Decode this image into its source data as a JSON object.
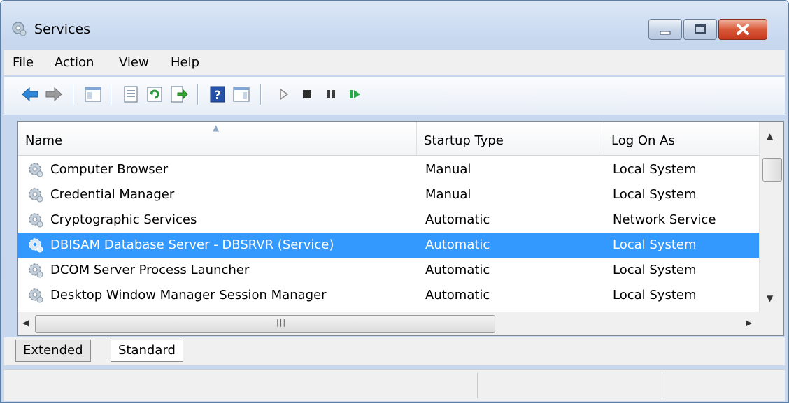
{
  "window": {
    "title": "Services",
    "icon": "services-gear-icon",
    "controls": [
      "minimize-icon",
      "maximize-icon",
      "close-icon"
    ]
  },
  "menu": [
    {
      "label": "File"
    },
    {
      "label": "Action"
    },
    {
      "label": "View"
    },
    {
      "label": "Help"
    }
  ],
  "toolbar": {
    "buttons": [
      "back-arrow-icon",
      "forward-arrow-icon",
      "show-hide-console-tree-icon",
      "properties-icon",
      "refresh-icon",
      "export-list-icon",
      "help-icon",
      "show-hide-action-pane-icon",
      "start-service-icon",
      "stop-service-icon",
      "pause-service-icon",
      "resume-service-icon"
    ]
  },
  "list": {
    "columns": [
      "Name",
      "Startup Type",
      "Log On As"
    ],
    "sorted_column": "Name",
    "rows": [
      {
        "name": "Computer Browser",
        "startup": "Manual",
        "logon": "Local System"
      },
      {
        "name": "Credential Manager",
        "startup": "Manual",
        "logon": "Local System"
      },
      {
        "name": "Cryptographic Services",
        "startup": "Automatic",
        "logon": "Network Service"
      },
      {
        "name": "DBISAM Database Server - DBSRVR (Service)",
        "startup": "Automatic",
        "logon": "Local System"
      },
      {
        "name": "DCOM Server Process Launcher",
        "startup": "Automatic",
        "logon": "Local System"
      },
      {
        "name": "Desktop Window Manager Session Manager",
        "startup": "Automatic",
        "logon": "Local System"
      }
    ],
    "selected_index": 3
  },
  "tabs": [
    {
      "label": "Extended"
    },
    {
      "label": "Standard"
    }
  ],
  "active_tab": "Standard",
  "colors": {
    "selection": "#3399ff",
    "title_bg": "#c6d7ee",
    "close_red": "#c6381d"
  }
}
